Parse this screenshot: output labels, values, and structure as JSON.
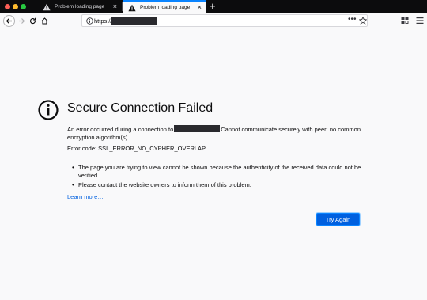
{
  "window": {
    "tabs": [
      {
        "label": "Problem loading page",
        "active": false
      },
      {
        "label": "Problem loading page",
        "active": true
      }
    ]
  },
  "toolbar": {
    "url_prefix": "https://"
  },
  "error": {
    "title": "Secure Connection Failed",
    "description_prefix": "An error occurred during a connection to",
    "description_suffix": "Cannot communicate securely with peer: no common encryption algorithm(s).",
    "error_code": "Error code: SSL_ERROR_NO_CYPHER_OVERLAP",
    "bullets": [
      "The page you are trying to view cannot be shown because the authenticity of the received data could not be verified.",
      "Please contact the website owners to inform them of this problem."
    ],
    "learn_more": "Learn more…",
    "try_again": "Try Again"
  },
  "colors": {
    "accent": "#0060df",
    "tabstrip": "#0c0c0d",
    "active_tab_line": "#0a84ff"
  }
}
